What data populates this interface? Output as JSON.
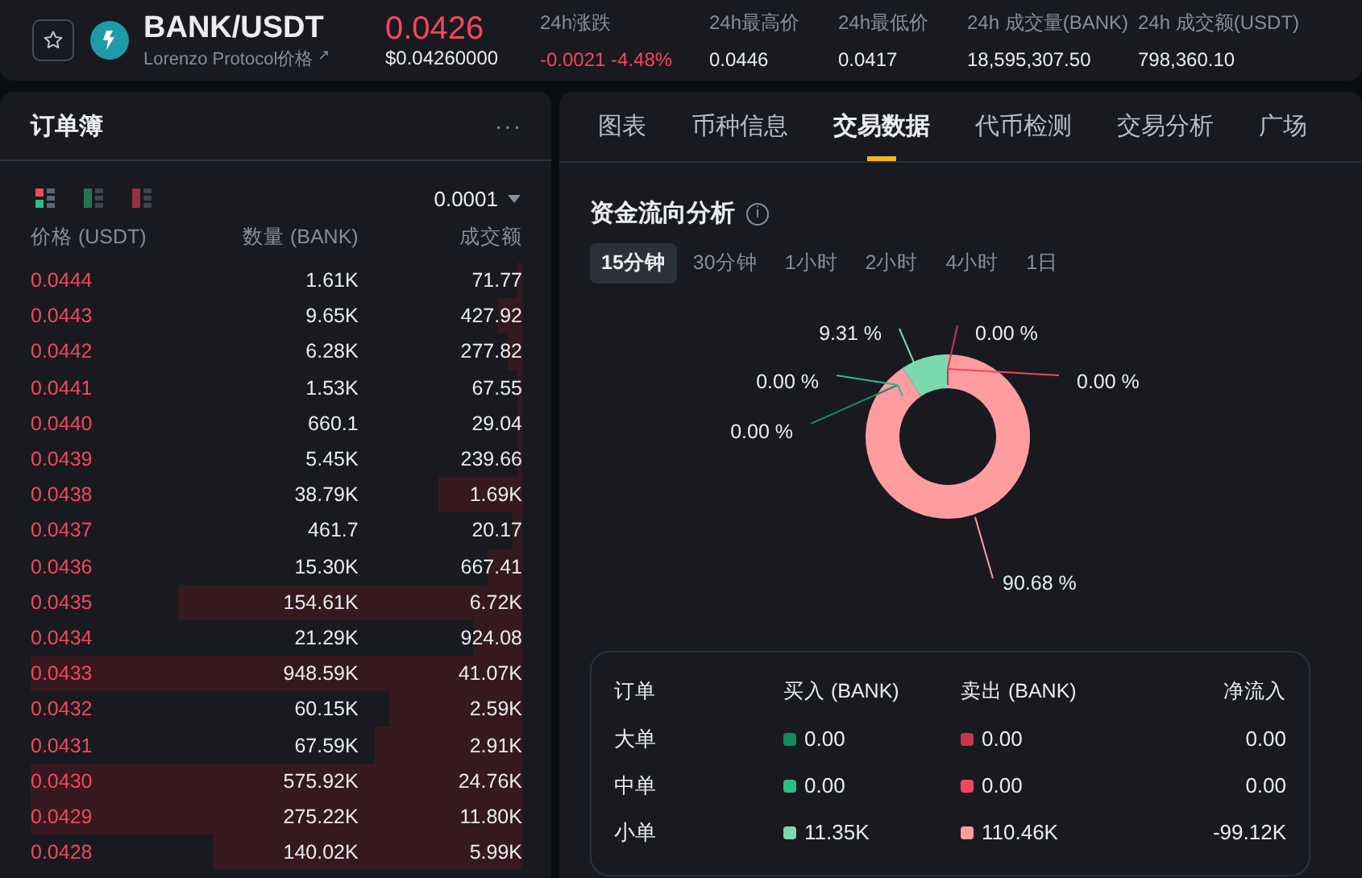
{
  "ticker": {
    "symbol": "BANK/USDT",
    "subtitle": "Lorenzo Protocol价格",
    "subtitle_link_icon": "↗",
    "price": "0.0426",
    "price_usd": "$0.04260000",
    "stats": [
      {
        "label": "24h涨跌",
        "value": "-0.0021 -4.48%",
        "kind": "down"
      },
      {
        "label": "24h最高价",
        "value": "0.0446",
        "kind": "plain"
      },
      {
        "label": "24h最低价",
        "value": "0.0417",
        "kind": "plain"
      },
      {
        "label": "24h 成交量(BANK)",
        "value": "18,595,307.50",
        "kind": "plain"
      },
      {
        "label": "24h 成交额(USDT)",
        "value": "798,360.10",
        "kind": "plain"
      }
    ]
  },
  "orderbook": {
    "title": "订单簿",
    "more": "···",
    "precision": "0.0001",
    "view_modes": [
      {
        "kind": "both",
        "selected": true
      },
      {
        "kind": "buy",
        "selected": false
      },
      {
        "kind": "sell",
        "selected": false
      }
    ],
    "columns": [
      "价格 (USDT)",
      "数量 (BANK)",
      "成交额"
    ],
    "rows": [
      {
        "price": "0.0444",
        "amount": "1.61K",
        "total": "71.77"
      },
      {
        "price": "0.0443",
        "amount": "9.65K",
        "total": "427.92"
      },
      {
        "price": "0.0442",
        "amount": "6.28K",
        "total": "277.82"
      },
      {
        "price": "0.0441",
        "amount": "1.53K",
        "total": "67.55"
      },
      {
        "price": "0.0440",
        "amount": "660.1",
        "total": "29.04"
      },
      {
        "price": "0.0439",
        "amount": "5.45K",
        "total": "239.66"
      },
      {
        "price": "0.0438",
        "amount": "38.79K",
        "total": "1.69K"
      },
      {
        "price": "0.0437",
        "amount": "461.7",
        "total": "20.17"
      },
      {
        "price": "0.0436",
        "amount": "15.30K",
        "total": "667.41"
      },
      {
        "price": "0.0435",
        "amount": "154.61K",
        "total": "6.72K"
      },
      {
        "price": "0.0434",
        "amount": "21.29K",
        "total": "924.08"
      },
      {
        "price": "0.0433",
        "amount": "948.59K",
        "total": "41.07K"
      },
      {
        "price": "0.0432",
        "amount": "60.15K",
        "total": "2.59K"
      },
      {
        "price": "0.0431",
        "amount": "67.59K",
        "total": "2.91K"
      },
      {
        "price": "0.0430",
        "amount": "575.92K",
        "total": "24.76K"
      },
      {
        "price": "0.0429",
        "amount": "275.22K",
        "total": "11.80K"
      },
      {
        "price": "0.0428",
        "amount": "140.02K",
        "total": "5.99K"
      }
    ]
  },
  "tabs": [
    {
      "label": "图表",
      "selected": false
    },
    {
      "label": "币种信息",
      "selected": false
    },
    {
      "label": "交易数据",
      "selected": true
    },
    {
      "label": "代币检测",
      "selected": false
    },
    {
      "label": "交易分析",
      "selected": false
    },
    {
      "label": "广场",
      "selected": false
    }
  ],
  "flow": {
    "title": "资金流向分析",
    "info_icon": "i",
    "periods": [
      {
        "label": "15分钟",
        "selected": true
      },
      {
        "label": "30分钟",
        "selected": false
      },
      {
        "label": "1小时",
        "selected": false
      },
      {
        "label": "2小时",
        "selected": false
      },
      {
        "label": "4小时",
        "selected": false
      },
      {
        "label": "1日",
        "selected": false
      }
    ],
    "chart_data": {
      "type": "donut",
      "value_labels": [
        "0.00 %",
        "0.00 %",
        "9.31 %",
        "0.00 %",
        "0.00 %",
        "90.68 %"
      ],
      "values": [
        0,
        0,
        9.31,
        0,
        0,
        90.68
      ]
    },
    "table": {
      "columns": [
        "订单",
        "买入 (BANK)",
        "卖出 (BANK)",
        "净流入"
      ],
      "rows": [
        {
          "label": "大单",
          "buy": {
            "value": "0.00",
            "color": "#148a5e"
          },
          "sell": {
            "value": "0.00",
            "color": "#c93550"
          },
          "net": "0.00"
        },
        {
          "label": "中单",
          "buy": {
            "value": "0.00",
            "color": "#2ebd85"
          },
          "sell": {
            "value": "0.00",
            "color": "#f6465d"
          },
          "net": "0.00"
        },
        {
          "label": "小单",
          "buy": {
            "value": "11.35K",
            "color": "#7ad9ad"
          },
          "sell": {
            "value": "110.46K",
            "color": "#ff9ca0"
          },
          "net": "-99.12K"
        }
      ]
    }
  }
}
